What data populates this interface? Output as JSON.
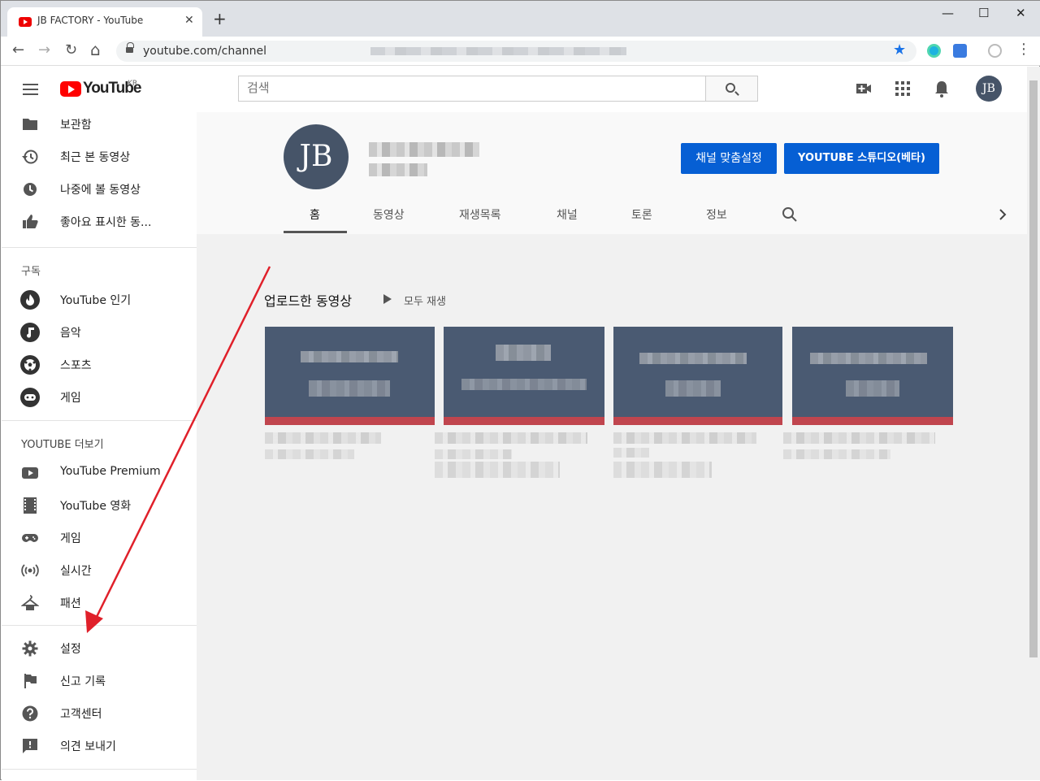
{
  "browser": {
    "tab_title": "JB FACTORY - YouTube",
    "tab_close": "✕",
    "new_tab": "+",
    "minimize": "—",
    "maximize": "☐",
    "close": "✕",
    "url": "youtube.com/channel",
    "back": "←",
    "forward": "→",
    "reload": "↻",
    "home": "⌂",
    "bookmark": "★",
    "menu": "⋮"
  },
  "header": {
    "logo_text": "YouTube",
    "logo_region": "KR",
    "search_placeholder": "검색",
    "avatar_initials": "JB"
  },
  "sidebar": {
    "top_items": [
      {
        "label": "보관함",
        "icon": "folder-icon"
      },
      {
        "label": "최근 본 동영상",
        "icon": "history-icon"
      },
      {
        "label": "나중에 볼 동영상",
        "icon": "clock-icon"
      },
      {
        "label": "좋아요 표시한 동...",
        "icon": "thumbs-up-icon"
      }
    ],
    "subscriptions_heading": "구독",
    "subscriptions": [
      {
        "label": "YouTube 인기",
        "icon": "flame-icon"
      },
      {
        "label": "음악",
        "icon": "music-icon"
      },
      {
        "label": "스포츠",
        "icon": "soccer-icon"
      },
      {
        "label": "게임",
        "icon": "gamepad-icon"
      }
    ],
    "more_heading": "YOUTUBE 더보기",
    "more_items": [
      {
        "label": "YouTube Premium",
        "icon": "youtube-icon"
      },
      {
        "label": "YouTube 영화",
        "icon": "film-icon"
      },
      {
        "label": "게임",
        "icon": "gamepad-icon"
      },
      {
        "label": "실시간",
        "icon": "live-icon"
      },
      {
        "label": "패션",
        "icon": "hanger-icon"
      }
    ],
    "bottom_items": [
      {
        "label": "설정",
        "icon": "gear-icon"
      },
      {
        "label": "신고 기록",
        "icon": "flag-icon"
      },
      {
        "label": "고객센터",
        "icon": "help-icon"
      },
      {
        "label": "의견 보내기",
        "icon": "feedback-icon"
      }
    ]
  },
  "channel": {
    "avatar_initials": "JB",
    "customize_button": "채널 맞춤설정",
    "studio_button": "YOUTUBE 스튜디오(베타)",
    "tabs": [
      "홈",
      "동영상",
      "재생목록",
      "채널",
      "토론",
      "정보"
    ],
    "active_tab": "홈",
    "section_title": "업로드한 동영상",
    "play_all": "모두 재생"
  },
  "colors": {
    "accent_blue": "#065fd4",
    "avatar_bg": "#465468",
    "annotation_arrow": "#e0202a"
  }
}
